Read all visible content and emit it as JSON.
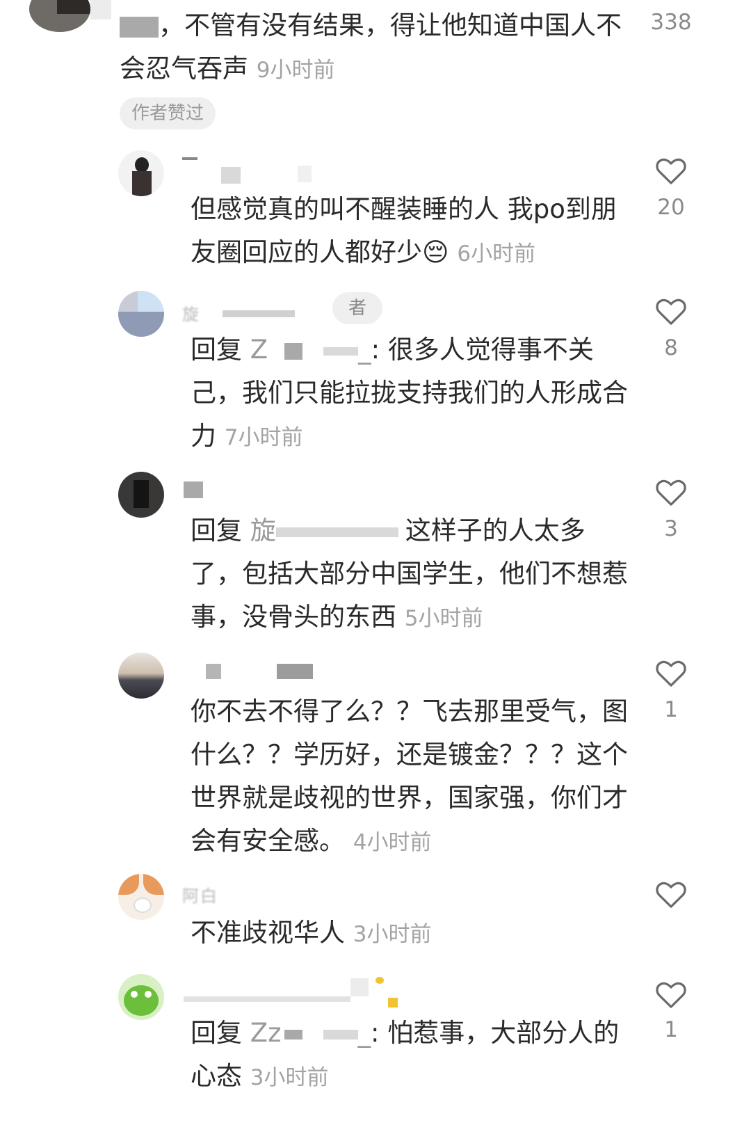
{
  "comments": [
    {
      "id": "c0",
      "text_prefix": "，",
      "text": "，不管有没有结果，得让他知道中国人不会忍气吞声",
      "time": "9小时前",
      "likes": "338",
      "badge": "作者赞过"
    },
    {
      "id": "c1",
      "text": "但感觉真的叫不醒装睡的人 我po到朋友圈回应的人都好少😔",
      "time": "6小时前",
      "likes": "20"
    },
    {
      "id": "c2",
      "name_fragment": "旋",
      "badge": "者",
      "reply_label": "回复",
      "reply_to": "Z",
      "reply_to_tail": "_",
      "text": ": 很多人觉得事不关己，我们只能拉拢支持我们的人形成合力",
      "time": "7小时前",
      "likes": "8"
    },
    {
      "id": "c3",
      "reply_label": "回复",
      "reply_to": "旋",
      "text": "这样子的人太多了，包括大部分中国学生，他们不想惹事，没骨头的东西",
      "time": "5小时前",
      "likes": "3"
    },
    {
      "id": "c4",
      "text": "你不去不得了么？？飞去那里受气，图什么？？学历好，还是镀金？？？这个世界就是歧视的世界，国家强，你们才会有安全感。",
      "time": "4小时前",
      "likes": "1"
    },
    {
      "id": "c5",
      "name_fragment": "阿白",
      "text": "不准歧视华人",
      "time": "3小时前",
      "likes": ""
    },
    {
      "id": "c6",
      "reply_label": "回复",
      "reply_to": "Zz",
      "reply_to_tail": "_",
      "text": ": 怕惹事，大部分人的心态",
      "time": "3小时前",
      "likes": "1"
    }
  ],
  "colors": {
    "text": "#2a2a2a",
    "time": "#a3a3a3",
    "count": "#8a8a8a",
    "badge_bg": "#efefef"
  },
  "icons": {
    "like": "heart-outline-icon"
  }
}
